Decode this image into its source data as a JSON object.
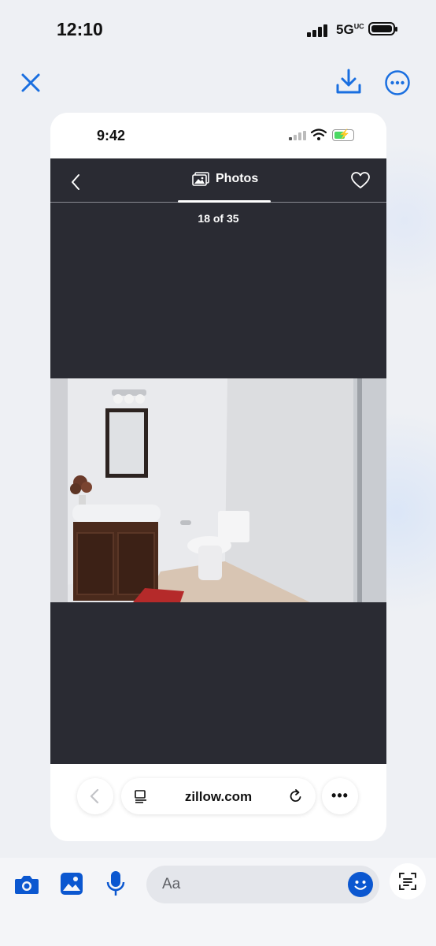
{
  "status_bar": {
    "time": "12:10",
    "network": "5G",
    "network_suffix": "UC"
  },
  "top_actions": {
    "close_icon": "close-icon",
    "download_icon": "download-icon",
    "more_icon": "more-icon"
  },
  "inner_screen": {
    "status_time": "9:42",
    "nav": {
      "title": "Photos",
      "back_icon": "chevron-left-icon",
      "heart_icon": "heart-icon",
      "photos_icon": "photos-icon"
    },
    "counter": "18 of 35",
    "browser": {
      "url": "zillow.com",
      "more_label": "•••"
    }
  },
  "composer": {
    "placeholder": "Aa"
  },
  "colors": {
    "accent": "#0b57d0",
    "dark_panel": "#2a2b33"
  }
}
